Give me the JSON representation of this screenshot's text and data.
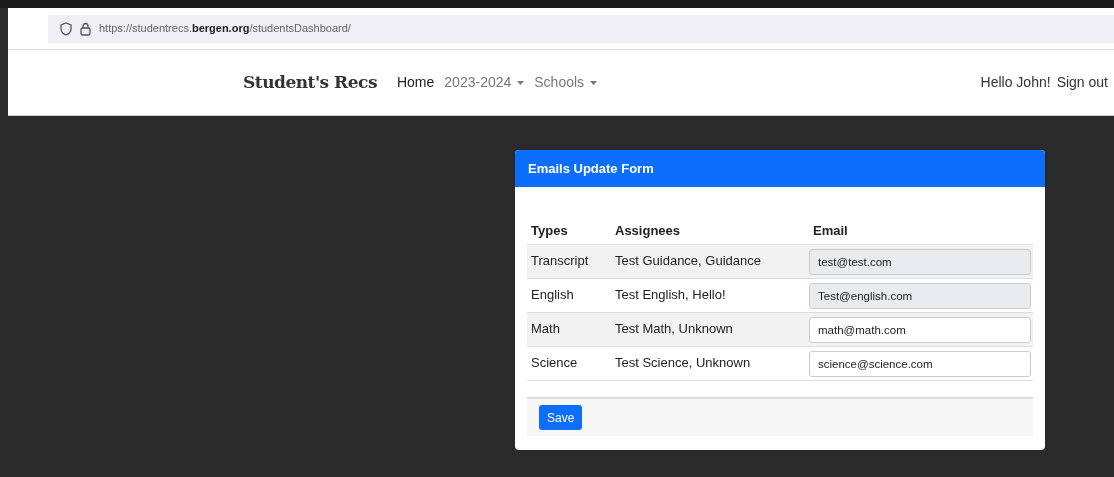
{
  "address_bar": {
    "url": "https://studentrecs.**bergen.org**/studentsDashboard/"
  },
  "navbar": {
    "brand": "Student's Recs",
    "items": [
      {
        "label": "Home",
        "kind": "link",
        "selected": true
      },
      {
        "label": "2023-2024",
        "kind": "dropdown",
        "selected": false
      },
      {
        "label": "Schools",
        "kind": "dropdown",
        "selected": false
      }
    ],
    "greeting": "Hello John!",
    "sign_out": "Sign out"
  },
  "card": {
    "title": "Emails Update Form",
    "columns": [
      "Types",
      "Assignees",
      "Email"
    ],
    "rows": [
      {
        "type": "Transcript",
        "assignees": "Test Guidance, Guidance",
        "email": "test@test.com",
        "disabled": true
      },
      {
        "type": "English",
        "assignees": "Test English, Hello!",
        "email": "Test@english.com",
        "disabled": true
      },
      {
        "type": "Math",
        "assignees": "Test Math, Unknown",
        "email": "math@math.com",
        "disabled": false
      },
      {
        "type": "Science",
        "assignees": "Test Science, Unknown",
        "email": "science@science.com",
        "disabled": false
      }
    ],
    "save_button": "Save"
  }
}
